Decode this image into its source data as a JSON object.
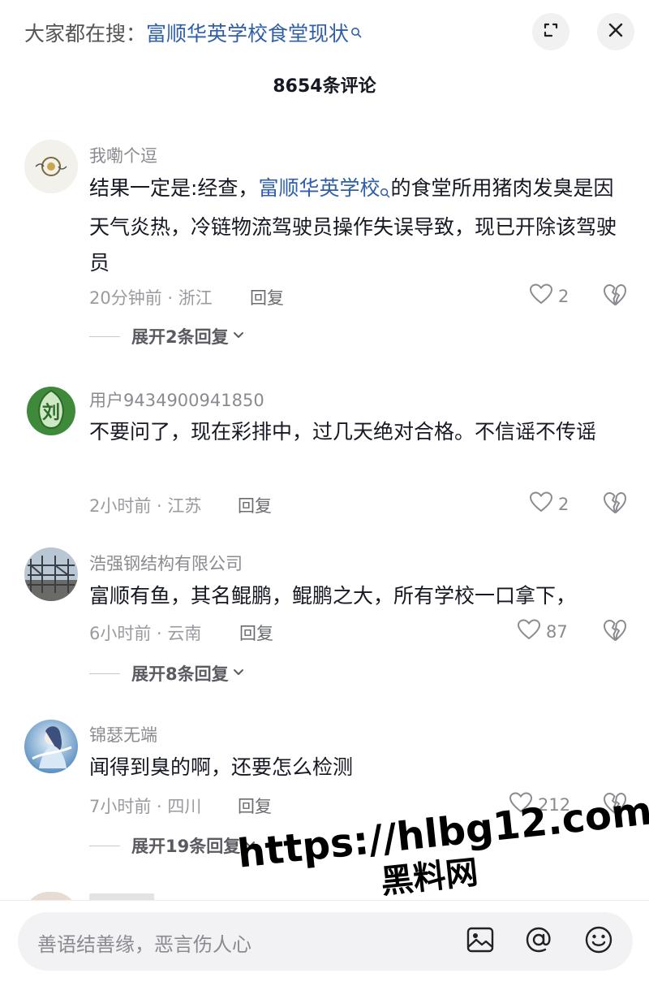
{
  "header": {
    "search_prefix": "大家都在搜：",
    "search_keyword": "富顺华英学校食堂现状"
  },
  "comment_count": "8654条评论",
  "comments": [
    {
      "username": "我嘞个逗",
      "text_before": "结果一定是:经查，",
      "text_keyword": "富顺华英学校",
      "text_after": "的食堂所用猪肉发臭是因天气炎热，冷链物流驾驶员操作失误导致，现已开除该驾驶员",
      "meta": "20分钟前 · 浙江",
      "reply_label": "回复",
      "likes": "2",
      "expand_label": "展开2条回复"
    },
    {
      "username": "用户9434900941850",
      "text": "不要问了，现在彩排中，过几天绝对合格。不信谣不传谣",
      "meta": "2小时前 · 江苏",
      "reply_label": "回复",
      "likes": "2"
    },
    {
      "username": "浩强钢结构有限公司",
      "text": "富顺有鱼，其名鲲鹏，鲲鹏之大，所有学校一口拿下，",
      "meta": "6小时前 · 云南",
      "reply_label": "回复",
      "likes": "87",
      "expand_label": "展开8条回复"
    },
    {
      "username": "锦瑟无端",
      "text": "闻得到臭的啊，还要怎么检测",
      "meta": "7小时前 · 四川",
      "reply_label": "回复",
      "likes": "212",
      "expand_label": "展开19条回复"
    }
  ],
  "input": {
    "placeholder": "善语结善缘，恶言伤人心"
  },
  "watermark": {
    "url": "https://hlbg12.com",
    "name": "黑料网"
  },
  "icons": {
    "header": [
      "search-icon",
      "expand-icon",
      "close-icon"
    ],
    "comment": [
      "heart-icon",
      "broken-heart-icon",
      "chevron-down-icon"
    ],
    "footer": [
      "image-icon",
      "at-icon",
      "emoji-icon"
    ]
  },
  "colors": {
    "link": "#2f5fa8",
    "muted": "#8a8b91",
    "text": "#161823"
  }
}
